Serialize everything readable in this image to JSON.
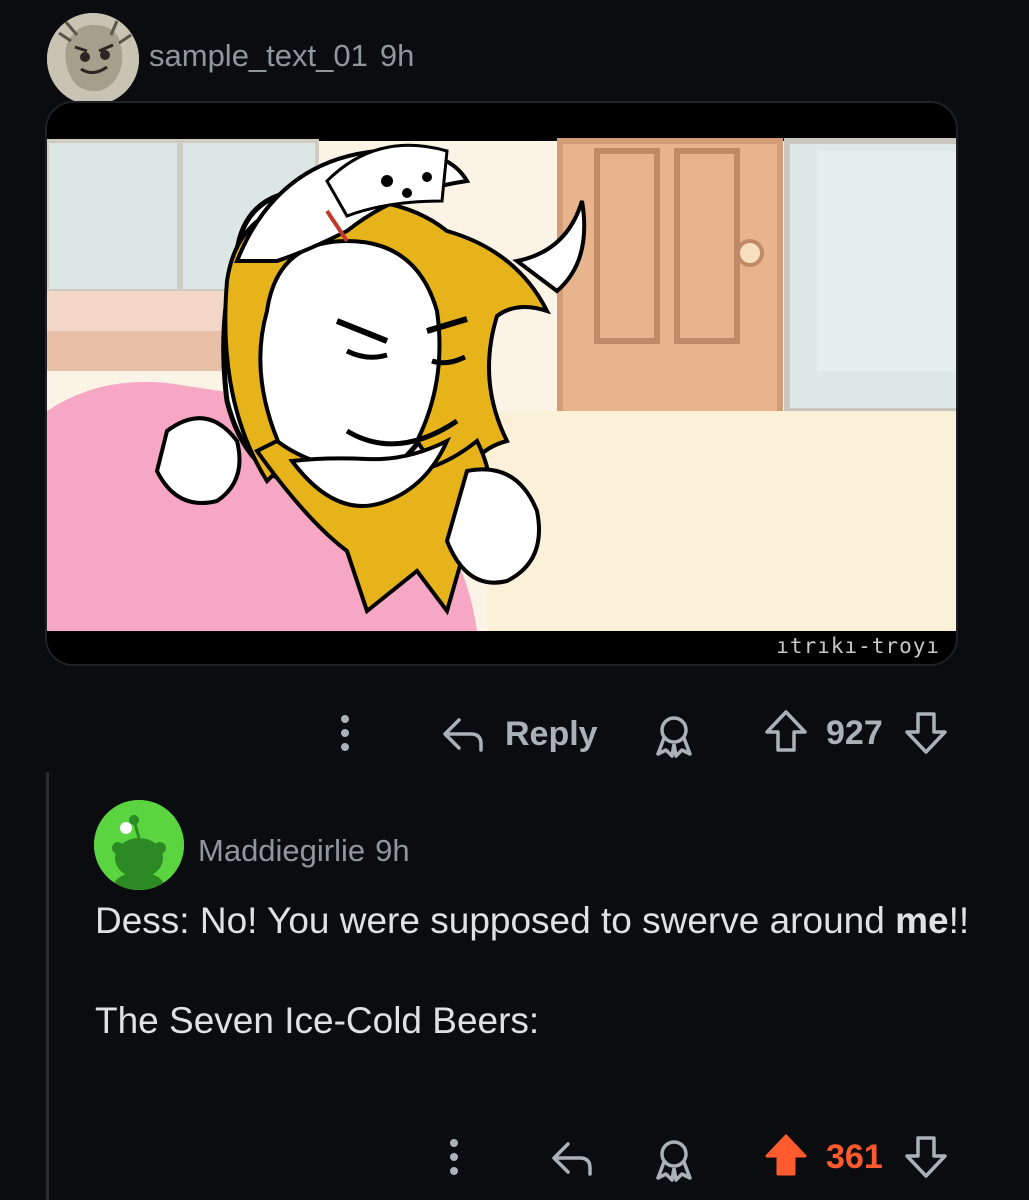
{
  "comment1": {
    "username": "sample_text_01",
    "time": "9h",
    "media": {
      "watermark": "ıtrıkı-troyı"
    },
    "actions": {
      "reply_label": "Reply",
      "score": "927"
    }
  },
  "comment2": {
    "username": "Maddiegirlie",
    "time": "9h",
    "body": {
      "line1_start": "Dess: No! You were supposed to swerve around ",
      "line1_bold": "me",
      "line1_end": "!!",
      "line2": "The Seven Ice-Cold Beers:"
    },
    "actions": {
      "score": "361",
      "upvoted": true
    }
  },
  "colors": {
    "background": "#0b0c10",
    "upvote": "#ff5b2e",
    "muted": "#8f969c"
  }
}
